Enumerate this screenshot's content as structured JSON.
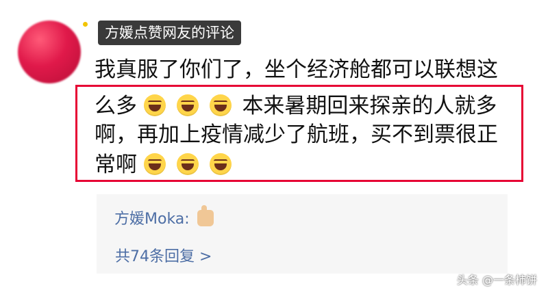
{
  "header": {
    "tag_label": "方媛点赞网友的评论"
  },
  "comment": {
    "line1": "我真服了你们了，坐个经济舱都可以联想这",
    "line2_prefix": "么多",
    "line2_suffix": "本来暑期回来探亲的人就多",
    "line3": "啊，再加上疫情减少了航班，买不到票很正",
    "line4_prefix": "常啊",
    "emoji_name": "laugh-cry-emoji",
    "highlight_color": "#e60033"
  },
  "reply": {
    "author": "方媛Moka:",
    "reaction_icon": "thumbs-up-icon",
    "count_label": "共74条回复 >"
  },
  "watermark": {
    "text": "头条 @一条柿饼"
  }
}
